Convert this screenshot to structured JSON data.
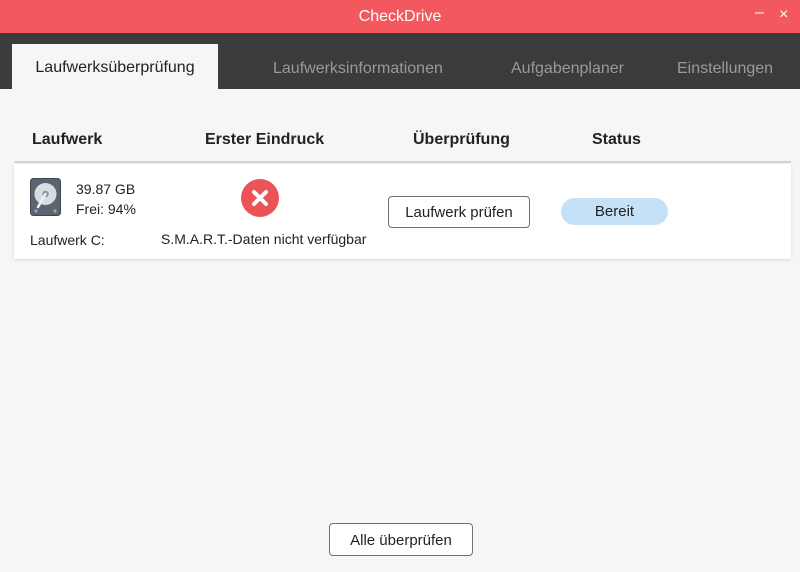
{
  "app": {
    "title": "CheckDrive"
  },
  "window_controls": {
    "minimize": "–",
    "close": "×"
  },
  "tabs": [
    {
      "label": "Laufwerksüberprüfung",
      "active": true
    },
    {
      "label": "Laufwerksinformationen",
      "active": false
    },
    {
      "label": "Aufgabenplaner",
      "active": false
    },
    {
      "label": "Einstellungen",
      "active": false
    }
  ],
  "table": {
    "headers": [
      "Laufwerk",
      "Erster Eindruck",
      "Überprüfung",
      "Status"
    ],
    "rows": [
      {
        "size": "39.87 GB",
        "free": "Frei: 94%",
        "name": "Laufwerk C:",
        "icon": "hard-drive-icon",
        "impression_icon": "error-x-icon",
        "impression": "S.M.A.R.T.-Daten nicht verfügbar",
        "action": "Laufwerk prüfen",
        "status": "Bereit"
      }
    ]
  },
  "footer": {
    "check_all": "Alle überprüfen"
  },
  "colors": {
    "titlebar": "#f2585e",
    "tabbar": "#3b3b3b",
    "error": "#ec5357",
    "status_pill": "#c4e1f7"
  }
}
